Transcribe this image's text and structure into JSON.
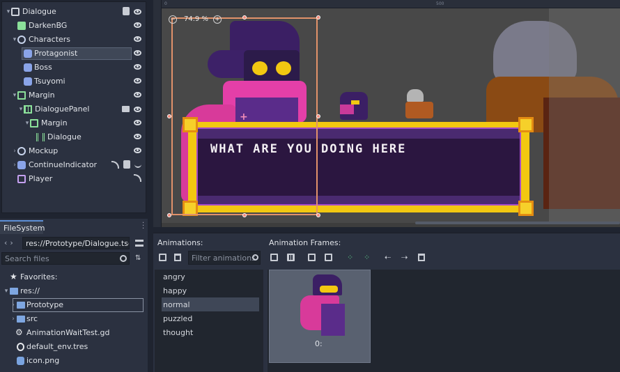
{
  "scene_tree": {
    "nodes": [
      {
        "label": "Dialogue",
        "icon": "control-root-icon",
        "depth": 0,
        "expanded": true,
        "extra_icons": [
          "script-icon"
        ],
        "visible": true
      },
      {
        "label": "DarkenBG",
        "icon": "color-rect-icon",
        "depth": 1,
        "extra_icons": [],
        "visible": true
      },
      {
        "label": "Characters",
        "icon": "node-circle-icon",
        "depth": 1,
        "expanded": true,
        "extra_icons": [],
        "visible": true
      },
      {
        "label": "Protagonist",
        "icon": "animated-sprite-icon",
        "depth": 2,
        "selected": true,
        "extra_icons": [],
        "visible": true
      },
      {
        "label": "Boss",
        "icon": "animated-sprite-icon",
        "depth": 2,
        "extra_icons": [],
        "visible": true
      },
      {
        "label": "Tsuyomi",
        "icon": "animated-sprite-icon",
        "depth": 2,
        "extra_icons": [],
        "visible": true
      },
      {
        "label": "Margin",
        "icon": "margin-container-icon",
        "depth": 1,
        "expanded": true,
        "extra_icons": [],
        "visible": true
      },
      {
        "label": "DialoguePanel",
        "icon": "nine-patch-icon",
        "depth": 2,
        "expanded": true,
        "extra_icons": [
          "film-icon"
        ],
        "visible": true
      },
      {
        "label": "Margin",
        "icon": "margin-container-icon",
        "depth": 3,
        "expanded": true,
        "extra_icons": [],
        "visible": true
      },
      {
        "label": "Dialogue",
        "icon": "rich-text-icon",
        "depth": 4,
        "extra_icons": [],
        "visible": true
      },
      {
        "label": "Mockup",
        "icon": "node-circle-icon",
        "depth": 1,
        "collapsed": true,
        "extra_icons": [],
        "visible": true
      },
      {
        "label": "ContinueIndicator",
        "icon": "animated-sprite-icon",
        "depth": 1,
        "collapsed": true,
        "extra_icons": [
          "signal-icon",
          "script-icon",
          "visibility-icon"
        ],
        "visible": false
      },
      {
        "label": "Player",
        "icon": "animation-player-icon",
        "depth": 1,
        "extra_icons": [
          "signal-icon"
        ],
        "visible": null
      }
    ]
  },
  "viewport": {
    "zoom": "74.9 %",
    "ruler_marks": [
      "0",
      "500"
    ],
    "dialogue_text": "WHAT ARE YOU DOING HERE"
  },
  "filesystem": {
    "tab": "FileSystem",
    "path": "res://Prototype/Dialogue.tscn",
    "search_placeholder": "Search files",
    "favorites_label": "Favorites:",
    "entries": [
      {
        "label": "res://",
        "type": "folder",
        "depth": 0
      },
      {
        "label": "Prototype",
        "type": "folder",
        "depth": 1,
        "selected": true
      },
      {
        "label": "src",
        "type": "folder",
        "depth": 1
      },
      {
        "label": "AnimationWaitTest.gd",
        "type": "gear",
        "depth": 1
      },
      {
        "label": "default_env.tres",
        "type": "globe",
        "depth": 1
      },
      {
        "label": "icon.png",
        "type": "image",
        "depth": 1
      }
    ]
  },
  "animation_panel": {
    "animations_label": "Animations:",
    "frames_label": "Animation Frames:",
    "filter_placeholder": "Filter animations",
    "animations": [
      "angry",
      "happy",
      "normal",
      "puzzled",
      "thought"
    ],
    "selected_animation": "normal",
    "frames": [
      {
        "label": "0:"
      }
    ]
  },
  "colors": {
    "panel_bg": "#2b3140",
    "accent": "#5d8fd6",
    "selection_rect": "#e2926a",
    "dialogue_frame": "#f2c811",
    "dialogue_bg": "#2b1640"
  }
}
